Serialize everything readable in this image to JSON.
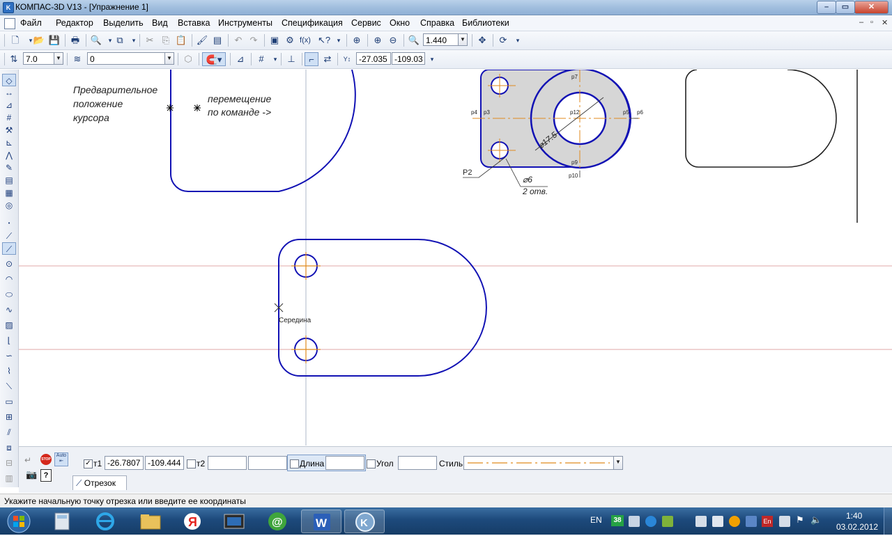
{
  "titlebar": {
    "title": "КОМПАС-3D V13 - [Упражнение 1]"
  },
  "menu": {
    "items": [
      "Файл",
      "Редактор",
      "Выделить",
      "Вид",
      "Вставка",
      "Инструменты",
      "Спецификация",
      "Сервис",
      "Окно",
      "Справка",
      "Библиотеки"
    ]
  },
  "toolbar1": {
    "zoom": "1.440"
  },
  "toolbar2": {
    "step": "7.0",
    "layer": "0",
    "coord_x": "-27.035",
    "coord_y": "-109.03"
  },
  "canvas": {
    "note_cursor": [
      "Предварительное",
      "положение",
      "курсора"
    ],
    "note_move": [
      "перемещение",
      "по команде ->"
    ],
    "snap_label": "Середина",
    "dim_diameter": "⌀17.5",
    "dim_hole": "⌀6",
    "dim_holes_count": "2 отв.",
    "leader_label": "P2",
    "point_labels": {
      "p4": "p4",
      "p3": "p3",
      "p7": "p7",
      "p12": "p12",
      "p5": "p5",
      "p6": "p6",
      "p9": "p9",
      "p10": "p10"
    }
  },
  "properties": {
    "t1_label": "т1",
    "t1_x": "-26.7807",
    "t1_y": "-109.444",
    "t2_label": "т2",
    "t2_x": "",
    "t2_y": "",
    "length_label": "Длина",
    "length_value": "",
    "angle_label": "Угол",
    "angle_value": "",
    "style_label": "Стиль",
    "tab_label": "Отрезок",
    "auto_label": "Auto",
    "stop_label": "STOP"
  },
  "status": {
    "hint": "Укажите начальную точку отрезка или введите ее координаты"
  },
  "taskbar": {
    "lang": "EN",
    "badge": "38",
    "time": "1:40",
    "date": "03.02.2012",
    "tray_lang": "En"
  },
  "colors": {
    "geometry": "#1212b4",
    "axis": "#e08a1e",
    "cursor_line": "#d88a8a",
    "part_fill": "#d6d6d6"
  }
}
